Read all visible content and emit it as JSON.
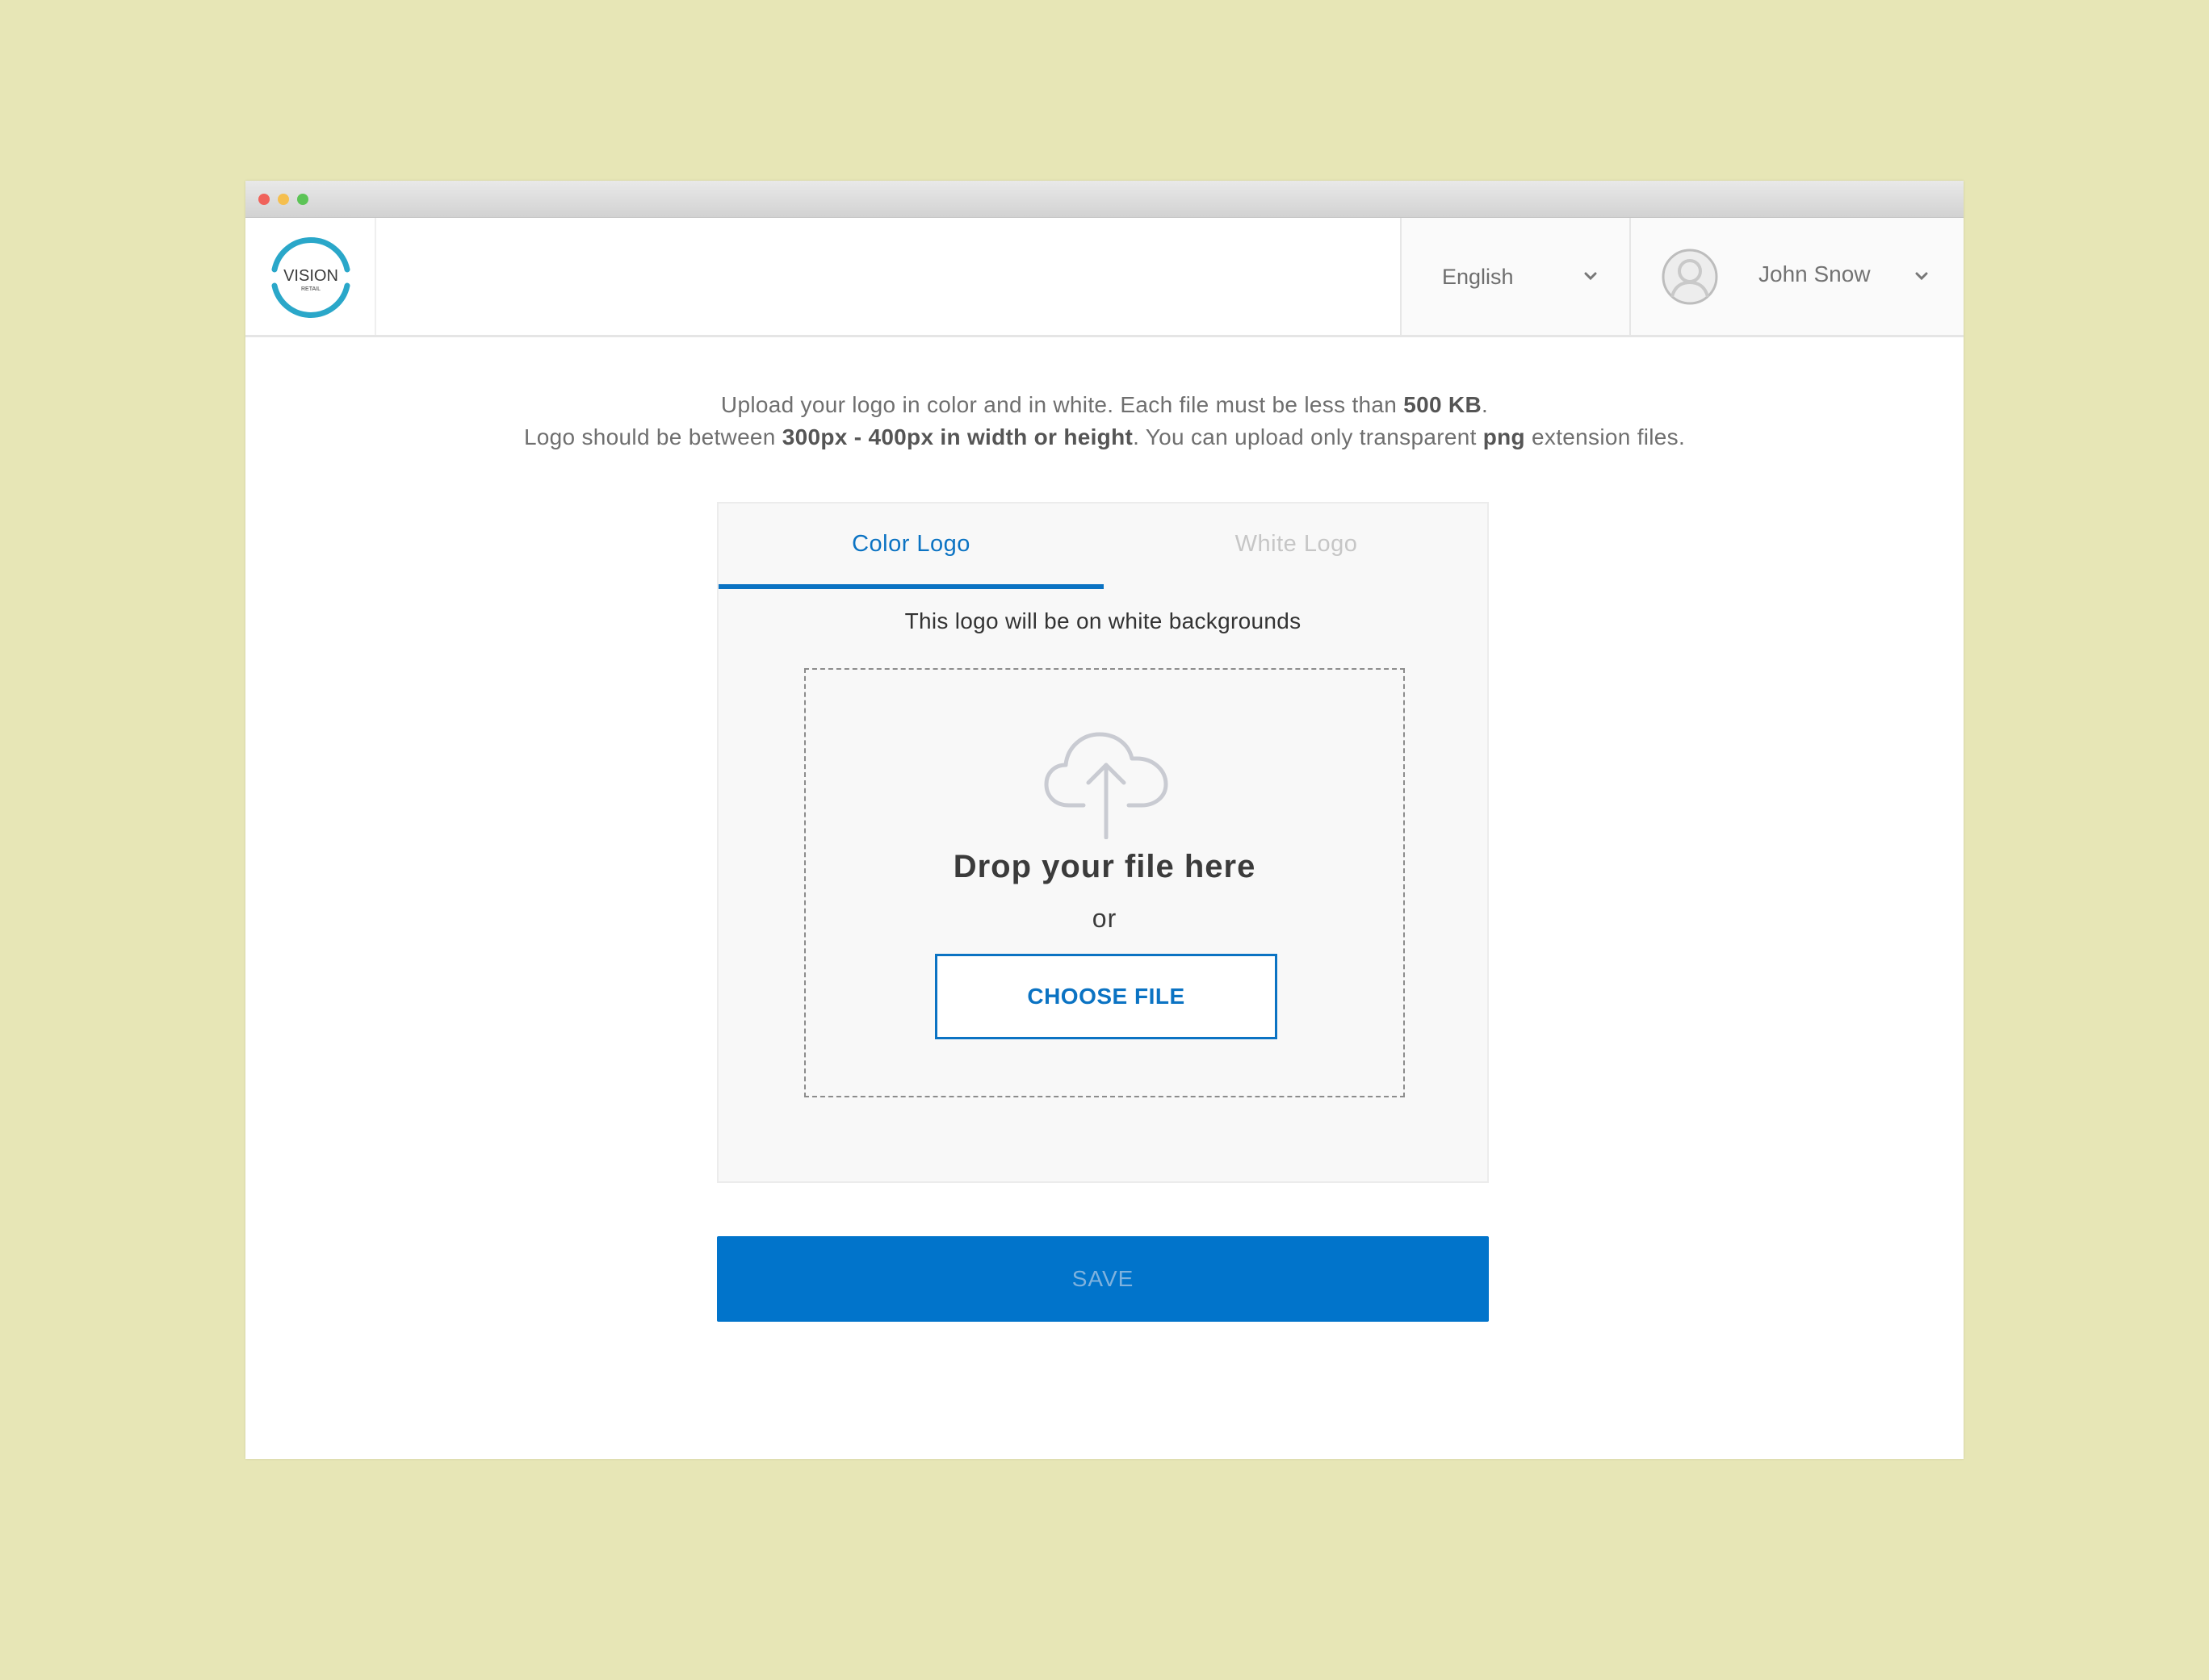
{
  "window": {
    "controls": [
      "close",
      "minimize",
      "zoom"
    ]
  },
  "header": {
    "logo": {
      "text": "VISION",
      "subtext": "RETAIL",
      "accent": "#2aa7c9"
    },
    "language": {
      "selected": "English",
      "icon": "chevron-down-icon"
    },
    "user": {
      "name": "John Snow",
      "icon": "chevron-down-icon",
      "avatar": "user-avatar-icon"
    }
  },
  "instructions": {
    "line1_prefix": "Upload your logo in color and in white. Each file must be less than ",
    "line1_bold": "500 KB",
    "line1_suffix": ".",
    "line2_prefix": "Logo should be between ",
    "line2_bold": "300px - 400px in width or height",
    "line2_mid": ". You can upload only transparent ",
    "line2_bold2": "png",
    "line2_suffix": " extension files."
  },
  "upload": {
    "tabs": [
      {
        "label": "Color Logo",
        "active": true
      },
      {
        "label": "White Logo",
        "active": false
      }
    ],
    "note": "This logo will be on white backgrounds",
    "dropzone": {
      "icon": "cloud-upload-icon",
      "title": "Drop your file here",
      "or": "or",
      "choose_label": "CHOOSE FILE"
    }
  },
  "actions": {
    "save_label": "SAVE"
  },
  "colors": {
    "primary": "#0174cb",
    "background": "#e7e6b6"
  }
}
